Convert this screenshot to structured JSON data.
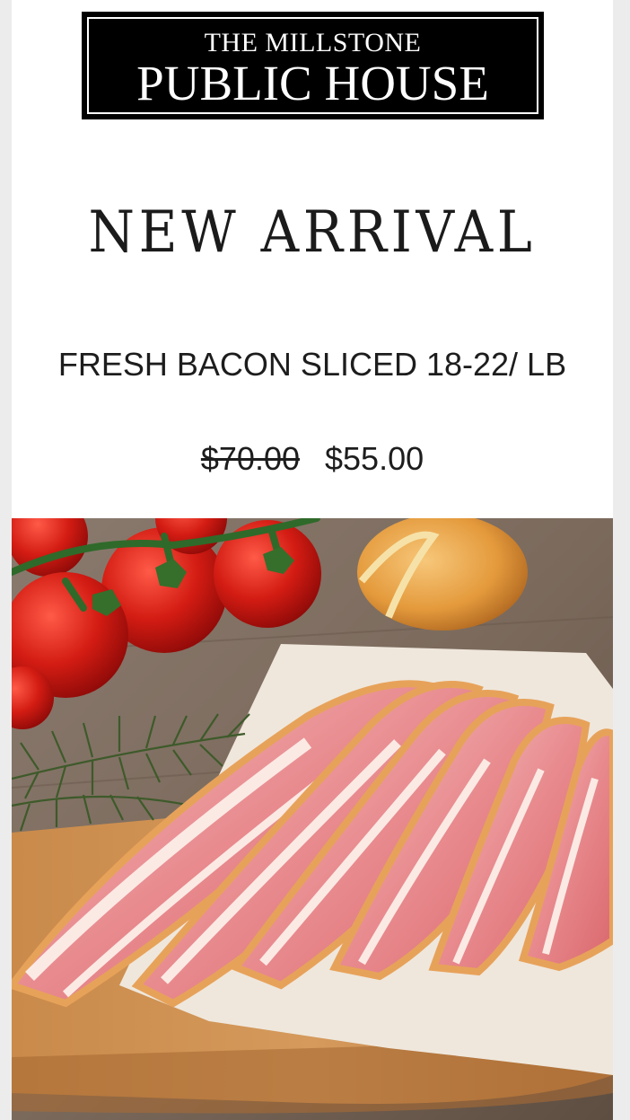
{
  "brand": {
    "line1": "THE MILLSTONE",
    "line2": "PUBLIC HOUSE"
  },
  "headline": "NEW ARRIVAL",
  "product": {
    "name": "FRESH BACON SLICED 18-22/ LB",
    "old_price": "$70.00",
    "price": "$55.00"
  },
  "image": {
    "subject": "sliced raw bacon on parchment with cherry tomatoes, onion and dill on wooden cutting board"
  }
}
